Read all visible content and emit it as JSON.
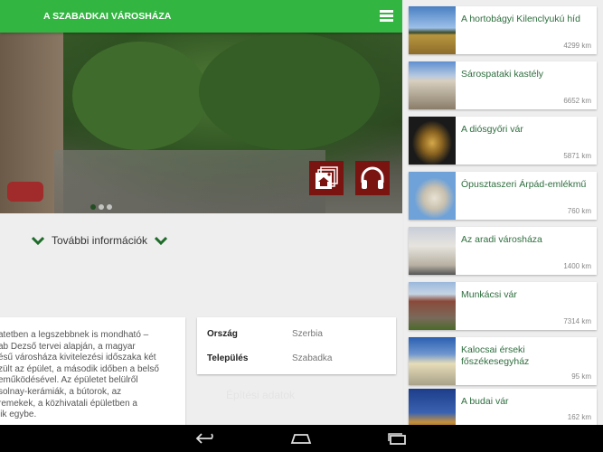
{
  "header": {
    "title": "A SZABADKAI VÁROSHÁZA",
    "menu_icon": "hamburger-icon",
    "color": "#33b542"
  },
  "gallery": {
    "dots": 3,
    "active_dot": 1,
    "buttons": [
      {
        "icon": "gallery-home-icon"
      },
      {
        "icon": "headphones-icon"
      }
    ],
    "button_color": "#7a1410"
  },
  "more_info": {
    "label": "További információk"
  },
  "description": {
    "lines": [
      "atetben a legszebbnek is mondható –",
      "ab Dezső tervei alapján, a magyar",
      "ésű városháza kivitelezési időszaka két",
      "zült az épület, a második időben a belső",
      "eműködésével. Az épületet belülről",
      "solnay-kerámiák, a bútorok, az",
      "remekek, a közhivatali épületben a",
      "lik egybe."
    ]
  },
  "info": {
    "rows": [
      {
        "label": "Ország",
        "value": "Szerbia"
      },
      {
        "label": "Település",
        "value": "Szabadka"
      }
    ]
  },
  "building_data_label": "Építési adatok",
  "places": [
    {
      "title": "A hortobágyi Kilenclyukú híd",
      "distance": "4299 km"
    },
    {
      "title": "Sárospataki kastély",
      "distance": "6652 km"
    },
    {
      "title": "A diósgyőri vár",
      "distance": "5871 km"
    },
    {
      "title": "Ópusztaszeri Árpád-emlékmű",
      "distance": "760 km"
    },
    {
      "title": "Az aradi városháza",
      "distance": "1400 km"
    },
    {
      "title": "Munkácsi vár",
      "distance": "7314 km"
    },
    {
      "title": "Kalocsai érseki főszékesegyház",
      "distance": "95 km"
    },
    {
      "title": "A budai vár",
      "distance": "162 km"
    }
  ],
  "navbar": {
    "icons": [
      "back-icon",
      "home-icon",
      "recent-apps-icon"
    ]
  }
}
